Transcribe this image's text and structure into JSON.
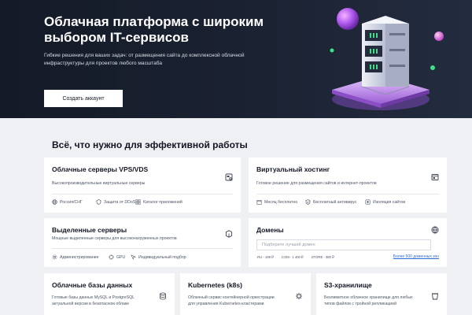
{
  "hero": {
    "title": "Облачная платформа с широким выбором IT-сервисов",
    "subtitle": "Гибкие решения для ваших задач: от размещения сайта до комплексной облачной инфраструктуры для проектов любого масштаба",
    "cta_label": "Создать аккаунт"
  },
  "section": {
    "title": "Всё, что нужно для эффективной работы"
  },
  "cards": {
    "vps": {
      "title": "Облачные серверы VPS/VDS",
      "desc": "Высокопроизводительные виртуальные серверы",
      "icon": "server-config-icon",
      "features": [
        "Россия/СНГ",
        "Защита от DDoS",
        "Каталог приложений"
      ]
    },
    "hosting": {
      "title": "Виртуальный хостинг",
      "desc": "Готовое решение для размещения сайтов и интернет-проектов",
      "icon": "browser-window-icon",
      "features": [
        "Месяц бесплатно",
        "Бесплатный антивирус",
        "Изоляция сайтов"
      ]
    },
    "dedicated": {
      "title": "Выделенные серверы",
      "desc": "Мощные выделенные серверы для высоконагруженных проектов",
      "icon": "server-box-icon",
      "features": [
        "Администрирование",
        "GPU",
        "Индивидуальный подбор"
      ]
    },
    "domains": {
      "title": "Домены",
      "icon": "globe-icon",
      "search_placeholder": "Подберите лучший домен",
      "zones": [
        ".RU - 199 ₽",
        ".COM - 1 400 ₽",
        ".STORE - 380 ₽"
      ],
      "all_zones_link": "Более 500 доменных зон"
    },
    "db": {
      "title": "Облачные базы данных",
      "desc1": "Готовые базы данных MySQL и PostgreSQL",
      "desc2": "актуальной версии в безопасном облаке",
      "icon": "database-icon"
    },
    "k8s": {
      "title": "Kubernetes (k8s)",
      "desc1": "Облачный сервис контейнерной оркестрации",
      "desc2": "для управления Kubernetes-кластерами",
      "icon": "kubernetes-helm-icon"
    },
    "s3": {
      "title": "S3-хранилище",
      "desc1": "Безлимитное облачное хранилище для любых",
      "desc2": "типов файлов с тройной репликацией",
      "icon": "storage-bucket-icon"
    }
  },
  "colors": {
    "hero_bg": "#1b2232",
    "card_bg": "#ffffff",
    "page_bg": "#eef0f3",
    "link": "#2c6bd8",
    "accent_purple": "#b35cf0",
    "accent_green": "#3fe08a"
  }
}
